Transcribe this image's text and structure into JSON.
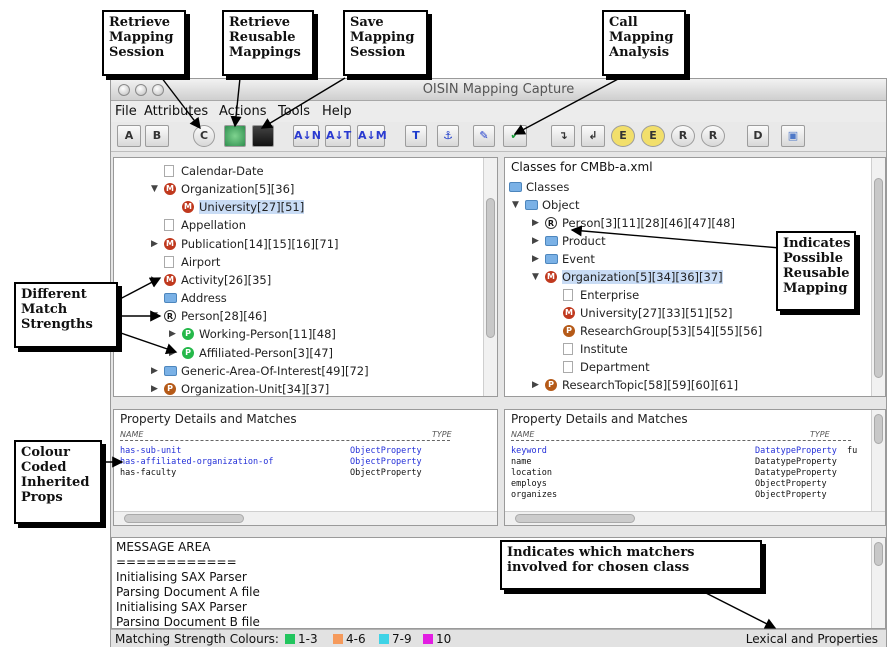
{
  "window": {
    "title": "OISIN Mapping Capture"
  },
  "menu": [
    "File",
    "Attributes",
    "Actions",
    "Tools",
    "Help"
  ],
  "toolbar": {
    "buttons": [
      {
        "label": "A",
        "icon": "open-folder-a-icon"
      },
      {
        "label": "B",
        "icon": "open-folder-b-icon"
      },
      {
        "label": "C",
        "icon": "retrieve-session-icon"
      },
      {
        "label": "",
        "icon": "retrieve-reusable-icon"
      },
      {
        "label": "",
        "icon": "save-icon"
      },
      {
        "label": "A↓N",
        "icon": "sort-name-icon"
      },
      {
        "label": "A↓T",
        "icon": "sort-type-icon"
      },
      {
        "label": "A↓M",
        "icon": "sort-match-icon"
      },
      {
        "label": "T",
        "icon": "text-icon"
      },
      {
        "label": "⚓",
        "icon": "anchor-icon"
      },
      {
        "label": "✎",
        "icon": "pen-icon"
      },
      {
        "label": "✔",
        "icon": "check-analysis-icon"
      },
      {
        "label": "↴",
        "icon": "arrow-right-icon"
      },
      {
        "label": "↲",
        "icon": "arrow-left-icon"
      },
      {
        "label": "E",
        "icon": "e-right-icon"
      },
      {
        "label": "E",
        "icon": "e-left-icon"
      },
      {
        "label": "R",
        "icon": "r-right-icon"
      },
      {
        "label": "R",
        "icon": "r-left-icon"
      },
      {
        "label": "D",
        "icon": "document-icon"
      },
      {
        "label": "▣",
        "icon": "window-icon"
      }
    ]
  },
  "left_tree": [
    {
      "label": "Calendar-Date",
      "icon": "doc",
      "tri": ""
    },
    {
      "label": "Organization[5][36]",
      "icon": "M",
      "tri": "▼"
    },
    {
      "label": "University[27][51]",
      "icon": "M",
      "tri": "",
      "selected": true
    },
    {
      "label": "Appellation",
      "icon": "doc",
      "tri": ""
    },
    {
      "label": "Publication[14][15][16][71]",
      "icon": "M",
      "tri": "▶"
    },
    {
      "label": "Airport",
      "icon": "doc",
      "tri": ""
    },
    {
      "label": "Activity[26][35]",
      "icon": "M",
      "tri": "▶"
    },
    {
      "label": "Address",
      "icon": "folder",
      "tri": ""
    },
    {
      "label": "Person[28][46]",
      "icon": "R",
      "tri": "▼"
    },
    {
      "label": "Working-Person[11][48]",
      "icon": "Pg",
      "tri": "▶"
    },
    {
      "label": "Affiliated-Person[3][47]",
      "icon": "Pg",
      "tri": "▶"
    },
    {
      "label": "Generic-Area-Of-Interest[49][72]",
      "icon": "folder",
      "tri": "▶"
    },
    {
      "label": "Organization-Unit[34][37]",
      "icon": "P",
      "tri": "▶"
    }
  ],
  "right_tree": {
    "header": "Classes for CMBb-a.xml",
    "rows": [
      {
        "label": "Classes",
        "icon": "folder",
        "tri": ""
      },
      {
        "label": "Object",
        "icon": "folder",
        "tri": "▼"
      },
      {
        "label": "Person[3][11][28][46][47][48]",
        "icon": "R",
        "tri": "▶"
      },
      {
        "label": "Product",
        "icon": "folder",
        "tri": "▶"
      },
      {
        "label": "Event",
        "icon": "folder",
        "tri": "▶"
      },
      {
        "label": "Organization[5][34][36][37]",
        "icon": "M",
        "tri": "▼",
        "selected": true
      },
      {
        "label": "Enterprise",
        "icon": "doc",
        "tri": ""
      },
      {
        "label": "University[27][33][51][52]",
        "icon": "M",
        "tri": ""
      },
      {
        "label": "ResearchGroup[53][54][55][56]",
        "icon": "P",
        "tri": ""
      },
      {
        "label": "Institute",
        "icon": "doc",
        "tri": ""
      },
      {
        "label": "Department",
        "icon": "doc",
        "tri": ""
      },
      {
        "label": "ResearchTopic[58][59][60][61]",
        "icon": "P",
        "tri": "▶"
      }
    ]
  },
  "left_props": {
    "title": "Property Details and Matches",
    "col_name": "NAME",
    "col_type": "TYPE",
    "rows": [
      {
        "name": "has-sub-unit",
        "type": "ObjectProperty",
        "inherited": true
      },
      {
        "name": "has-affiliated-organization-of",
        "type": "ObjectProperty",
        "inherited": true
      },
      {
        "name": "has-faculty",
        "type": "ObjectProperty",
        "inherited": false
      }
    ]
  },
  "right_props": {
    "title": "Property Details and Matches",
    "col_name": "NAME",
    "col_type": "TYPE",
    "rows": [
      {
        "name": "keyword",
        "type": "DatatypeProperty",
        "inherited": true,
        "extra": "fu"
      },
      {
        "name": "name",
        "type": "DatatypeProperty",
        "inherited": false
      },
      {
        "name": "location",
        "type": "DatatypeProperty",
        "inherited": false
      },
      {
        "name": "employs",
        "type": "ObjectProperty",
        "inherited": false
      },
      {
        "name": "organizes",
        "type": "ObjectProperty",
        "inherited": false
      }
    ]
  },
  "messages": {
    "lines": [
      "MESSAGE AREA",
      "============",
      "Initialising SAX Parser",
      "Parsing Document A file",
      "Initialising SAX Parser",
      "Parsing Document B file"
    ]
  },
  "status": {
    "label": "Matching Strength Colours:",
    "legend": [
      {
        "range": "1-3",
        "color": "#22c55e"
      },
      {
        "range": "4-6",
        "color": "#f59a5c"
      },
      {
        "range": "7-9",
        "color": "#3fd3e6"
      },
      {
        "range": "10",
        "color": "#e21de2"
      }
    ],
    "right": "Lexical and Properties"
  },
  "callouts": {
    "retrieve_session": "Retrieve Mapping Session",
    "retrieve_reusable": "Retrieve Reusable Mappings",
    "save_session": "Save Mapping Session",
    "call_analysis": "Call Mapping Analysis",
    "match_strengths": "Different Match Strengths",
    "reusable_mapping": "Indicates Possible Reusable Mapping",
    "colour_coded": "Colour Coded Inherited Props",
    "which_matchers": "Indicates which matchers involved for chosen class"
  }
}
